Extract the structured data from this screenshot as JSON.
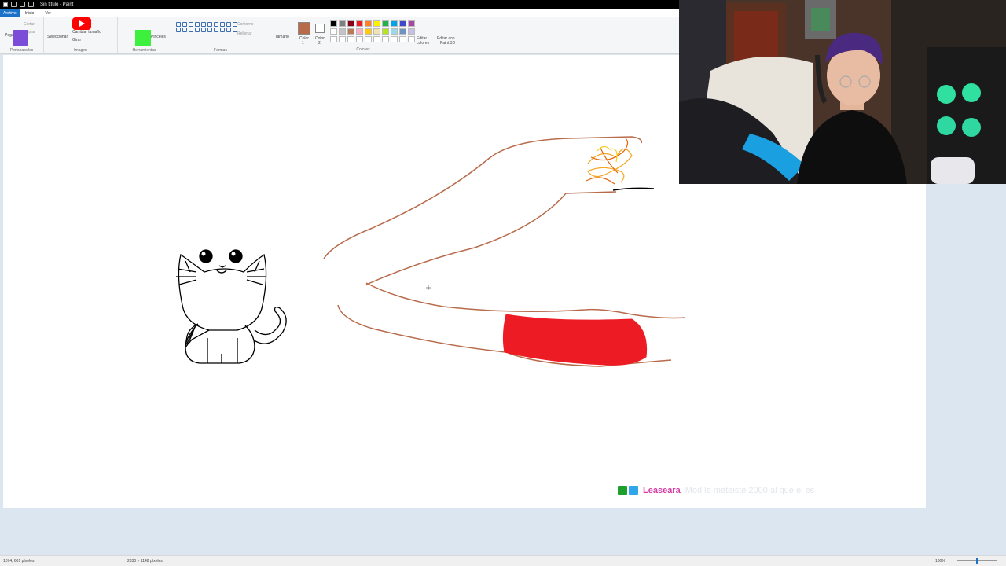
{
  "window": {
    "title": "Sin título - Paint"
  },
  "menu": {
    "file": "Archivo",
    "home": "Inicio",
    "view": "Ver"
  },
  "ribbon": {
    "clipboard": {
      "label": "Portapapeles",
      "paste": "Pegar",
      "cut": "Cortar",
      "copy": "Copiar"
    },
    "image": {
      "label": "Imagen",
      "select": "Seleccionar",
      "resize": "Cambiar tamaño",
      "rotate": "Girar"
    },
    "tools": {
      "label": "Herramientas",
      "brushes": "Pinceles"
    },
    "shapes": {
      "label": "Formas",
      "outline": "Contorno",
      "fill": "Rellenar"
    },
    "size": "Tamaño",
    "color1": {
      "line1": "Color",
      "line2": "1"
    },
    "color2": {
      "line1": "Color",
      "line2": "2"
    },
    "colors": {
      "label": "Colores"
    },
    "edit_colors": {
      "line1": "Editar",
      "line2": "colores"
    },
    "paint3d": {
      "line1": "Editar con",
      "line2": "Paint 3D"
    }
  },
  "colors": {
    "color1": "#b86b4b",
    "color2": "#ffffff",
    "palette_row1": [
      "#000000",
      "#7f7f7f",
      "#880015",
      "#ed1c24",
      "#ff7f27",
      "#fff200",
      "#22b14c",
      "#00a2e8",
      "#3f48cc",
      "#a349a4"
    ],
    "palette_row2": [
      "#ffffff",
      "#c3c3c3",
      "#b97a57",
      "#ffaec9",
      "#ffc90e",
      "#efe4b0",
      "#b5e61d",
      "#99d9ea",
      "#7092be",
      "#c8bfe7"
    ]
  },
  "chat": {
    "user": "Leaseara",
    "message": "Mod le meteiste 2000 al que el es"
  },
  "status": {
    "cursor": "1074, 601 píxeles",
    "size": "2330 × 1148 píxeles",
    "zoom": "100%"
  }
}
